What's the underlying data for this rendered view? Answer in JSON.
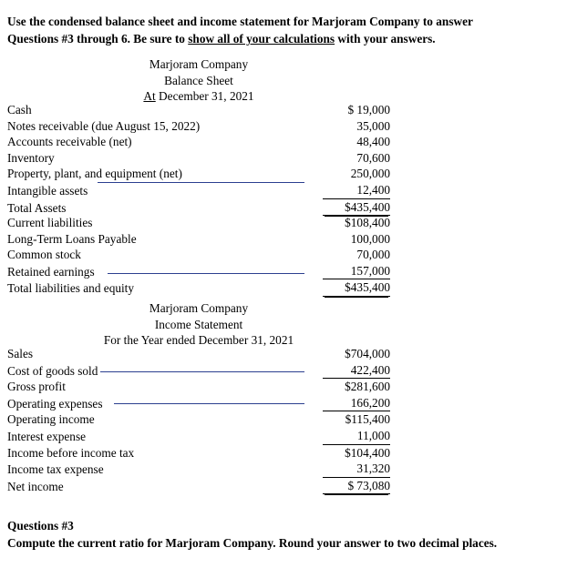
{
  "intro": {
    "line1_a": "Use the condensed balance sheet and income statement for ",
    "line1_b": "Marjoram Company",
    "line1_c": " to answer",
    "line2_a": "Questions #3 through 6.  Be sure to ",
    "line2_b": "show all of your calculations",
    "line2_c": " with your answers."
  },
  "balance_sheet": {
    "company": "Marjoram Company",
    "statement": "Balance Sheet",
    "date_prefix": "At",
    "date": " December 31, 2021",
    "assets": [
      {
        "label": "Cash",
        "amount": "$ 19,000",
        "rule": "none"
      },
      {
        "label": "Notes receivable (due August 15, 2022)",
        "amount": "35,000",
        "rule": "none"
      },
      {
        "label": "Accounts receivable (net)",
        "amount": "48,400",
        "rule": "none"
      },
      {
        "label": "Inventory",
        "amount": "70,600",
        "rule": "none"
      },
      {
        "label": "Property, plant, and equipment (net)",
        "amount": "250,000",
        "rule": "none"
      },
      {
        "label": "Intangible assets",
        "amount": "12,400",
        "rule": "single"
      },
      {
        "label": "Total Assets",
        "amount": "$435,400",
        "rule": "double",
        "indent": true
      }
    ],
    "liabilities": [
      {
        "label": "Current liabilities",
        "amount": "$108,400",
        "rule": "none"
      },
      {
        "label": "Long-Term Loans Payable",
        "amount": "100,000",
        "rule": "none"
      },
      {
        "label": "Common stock",
        "amount": "70,000",
        "rule": "none"
      },
      {
        "label": "Retained earnings",
        "amount": "157,000",
        "rule": "single"
      },
      {
        "label": "Total liabilities and equity",
        "amount": "$435,400",
        "rule": "double",
        "indent": true
      }
    ]
  },
  "income_statement": {
    "company": "Marjoram Company",
    "statement": "Income Statement",
    "period": "For the Year ended December 31, 2021",
    "rows": [
      {
        "label": "Sales",
        "amount": "$704,000",
        "rule": "none"
      },
      {
        "label": "Cost of goods sold",
        "amount": "422,400",
        "rule": "single"
      },
      {
        "label": "Gross profit",
        "amount": "$281,600",
        "rule": "none"
      },
      {
        "label": "Operating expenses",
        "amount": "166,200",
        "rule": "single"
      },
      {
        "label": "Operating income",
        "amount": "$115,400",
        "rule": "none"
      },
      {
        "label": "Interest expense",
        "amount": "11,000",
        "rule": "single"
      },
      {
        "label": "Income before income tax",
        "amount": "$104,400",
        "rule": "none"
      },
      {
        "label": "Income tax expense",
        "amount": "31,320",
        "rule": "single"
      },
      {
        "label": "Net income",
        "amount": "$ 73,080",
        "rule": "double",
        "indent": true
      }
    ]
  },
  "question": {
    "heading": "Questions #3",
    "prompt": "Compute the current ratio for Marjoram Company. Round your answer to two decimal places."
  },
  "colors": {
    "text": "#000000",
    "rule_blue": "#2b3f8f",
    "background": "#ffffff"
  }
}
